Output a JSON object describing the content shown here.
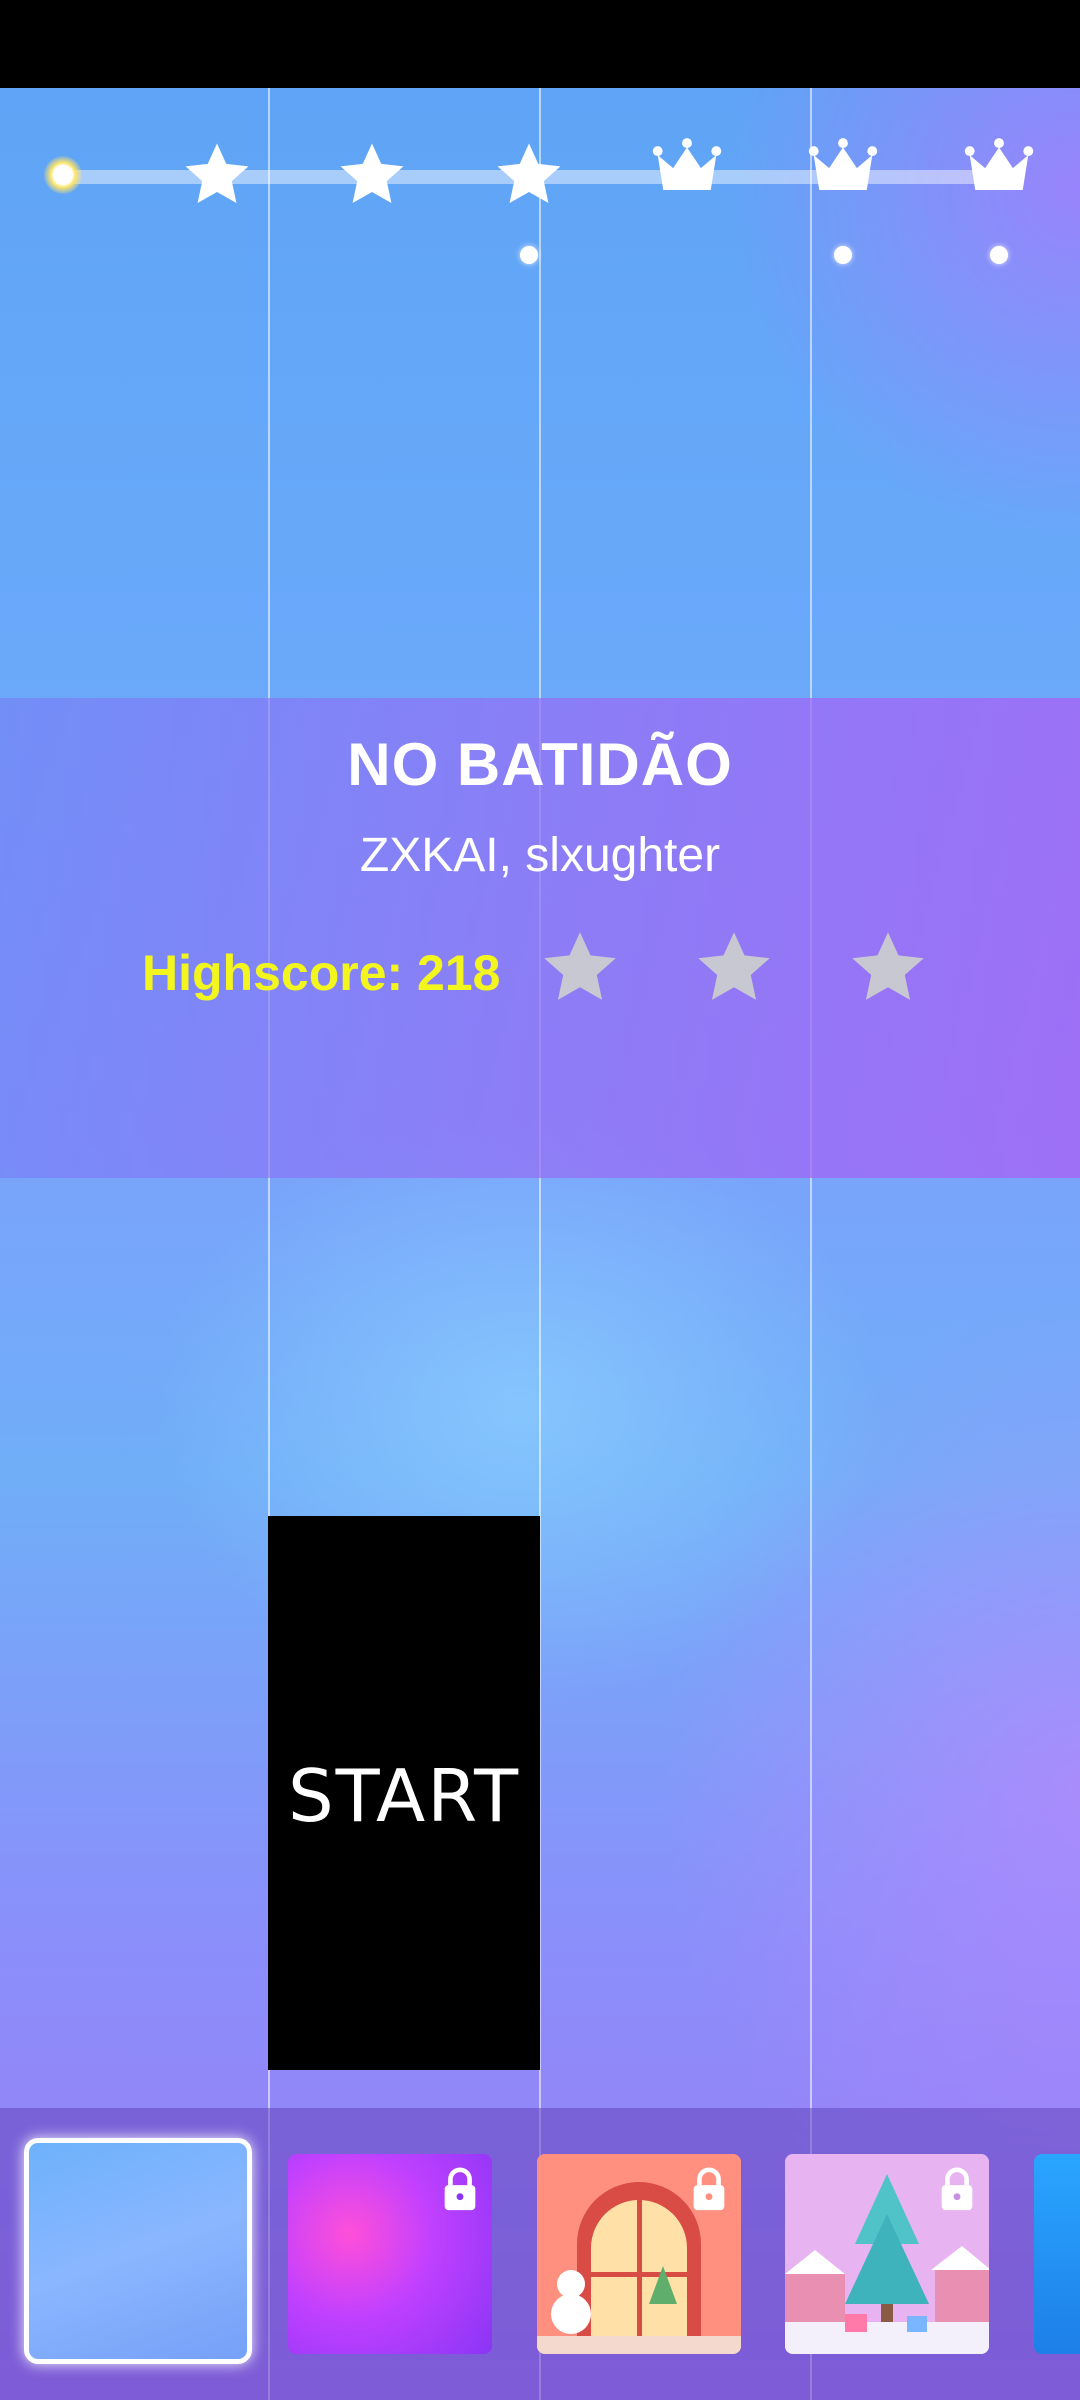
{
  "song": {
    "title": "NO BATIDÃO",
    "artist": "ZXKAI, slxughter",
    "highscore_text": "Highscore: 218",
    "stars_earned": 0,
    "stars_total": 3
  },
  "progress": {
    "fraction": 0.0,
    "milestones": [
      {
        "icon": "star-icon",
        "dot": false
      },
      {
        "icon": "star-icon",
        "dot": false
      },
      {
        "icon": "star-icon",
        "dot": true
      },
      {
        "icon": "crown-icon",
        "dot": false
      },
      {
        "icon": "crown-icon",
        "dot": true
      },
      {
        "icon": "crown-icon",
        "dot": true
      }
    ]
  },
  "start_tile": {
    "label": "START"
  },
  "themes": [
    {
      "name": "blue-gradient",
      "selected": true,
      "locked": false
    },
    {
      "name": "purple-gradient",
      "selected": false,
      "locked": true
    },
    {
      "name": "christmas-window",
      "selected": false,
      "locked": true
    },
    {
      "name": "christmas-tree",
      "selected": false,
      "locked": true
    },
    {
      "name": "blue-partial",
      "selected": false,
      "locked": false
    }
  ],
  "colors": {
    "highscore": "#f3f51f",
    "tile": "#000000",
    "star_inactive": "#c8c8d2"
  }
}
